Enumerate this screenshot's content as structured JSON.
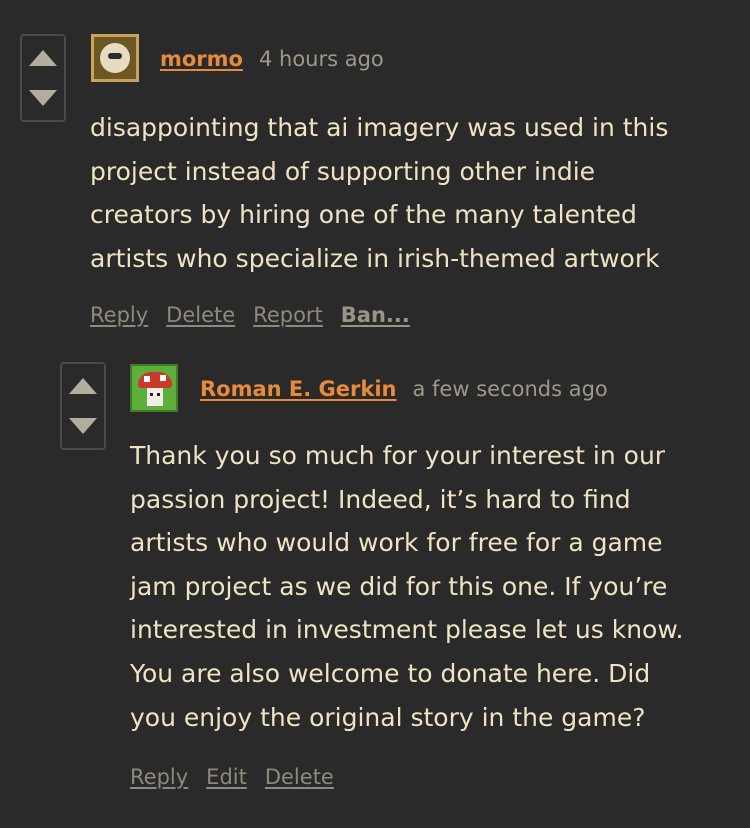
{
  "comments": [
    {
      "author": "mormo",
      "time": "4 hours ago",
      "avatar_icon": "mormo-avatar",
      "lines": [
        "disappointing that ai imagery was used in this",
        "project instead of supporting other indie",
        "creators by hiring one of the many talented",
        "artists who specialize in irish-themed artwork"
      ],
      "actions": [
        "Reply",
        "Delete",
        "Report",
        "Ban..."
      ]
    },
    {
      "author": "Roman E. Gerkin",
      "time": "a few seconds ago",
      "avatar_icon": "mushroom-avatar",
      "lines": [
        "Thank you so much for your interest in our",
        "passion project! Indeed, it’s hard to find",
        "artists who would work for free for a game",
        "jam project as we did for this one. If you’re",
        "interested in investment please let us know.",
        "You are also welcome to donate here. Did",
        "you enjoy the original story in the game?"
      ],
      "actions": [
        "Reply",
        "Edit",
        "Delete"
      ]
    }
  ],
  "colors": {
    "background": "#2a2a2a",
    "text": "#efe3c4",
    "author": "#e68a3c",
    "muted": "#9e978b",
    "vote_arrow": "#b3ad9f"
  }
}
